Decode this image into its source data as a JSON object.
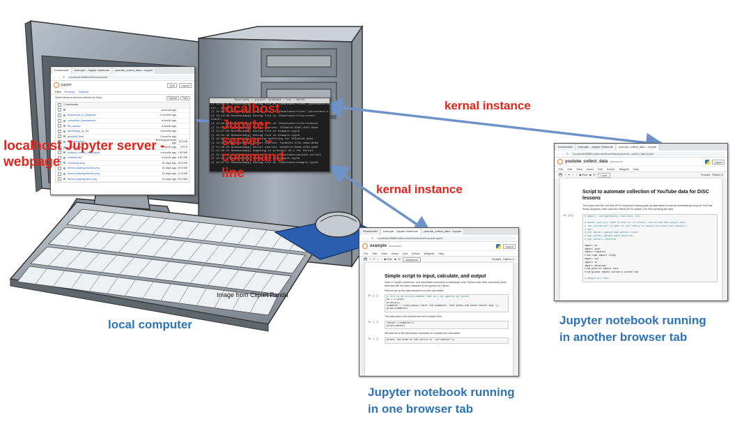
{
  "labels": {
    "kernal_top": "kernal instance",
    "kernal_mid": "kernal instance",
    "localhost_webpage": "localhost Jupyter server - webpage",
    "localhost_cmdline": "localhost Jupyter server – command line",
    "credit": "Image from Clipart Panda",
    "local_computer": "local computer",
    "nb_one_tab_line1": "Jupyter notebook running",
    "nb_one_tab_line2": "in one browser tab",
    "nb_another_tab_line1": "Jupyter notebook running",
    "nb_another_tab_line2": "in another browser tab"
  },
  "colors": {
    "label_red": "#e0251b",
    "label_blue": "#2e74b5",
    "arrow": "#6f93c9"
  },
  "tree_page": {
    "tab_labels": [
      "Downloads/",
      "example - Jupyter Notebook",
      "youtube_collect_data - Jupyter"
    ],
    "url": "localhost:8888/tree/Downloads",
    "logo_text": "jupyter",
    "quit_label": "Quit",
    "logout_label": "Logout",
    "tabs": [
      "Files",
      "Running",
      "Clusters"
    ],
    "select_hint": "Select items to perform actions on them.",
    "upload_label": "Upload",
    "new_label": "New",
    "breadcrumb": "/ Downloads",
    "files": [
      {
        "name": "..",
        "modified": "seconds ago",
        "size": ""
      },
      {
        "name": "bootcamps_in_progress",
        "modified": "2 months ago",
        "size": ""
      },
      {
        "name": "completed_transactions",
        "modified": "a month ago",
        "size": ""
      },
      {
        "name": "file_upload",
        "modified": "a month ago",
        "size": ""
      },
      {
        "name": "genealogy_ny_file",
        "modified": "4 months ago",
        "size": ""
      },
      {
        "name": "gradeoff_final",
        "modified": "2 months ago",
        "size": ""
      },
      {
        "name": "example.ipynb",
        "modified": "Running seconds ago",
        "size": "10.3 kB"
      },
      {
        "name": "rstudio.dmg",
        "modified": "a month ago",
        "size": "279 B"
      },
      {
        "name": "youtube_collect_data.ipynb",
        "modified": "4 months ago",
        "size": "1.69 MB"
      },
      {
        "name": "xnkiewx.dat",
        "modified": "a month ago",
        "size": "4.82 MB"
      },
      {
        "name": "christmas.dmg",
        "modified": "15 days ago",
        "size": "19.5 MB"
      },
      {
        "name": "demon-playing-kitchen.png",
        "modified": "15 days ago",
        "size": "20.8 MB"
      },
      {
        "name": "demon-playing-kitchen.png",
        "modified": "15 days ago",
        "size": "11.5 MB"
      },
      {
        "name": "demon-playing-fetch.png",
        "modified": "15 days ago",
        "size": "20.9 MB"
      }
    ]
  },
  "terminal": {
    "title": "Downloads — jupyter notebook — tty — 80×24",
    "lines": [
      "[I 11:04:21 NotebookApp] Saving file at /Downloads/files/.jjnotebook/conte",
      "nt/...ipynb",
      "[I 11:09:38 NotebookApp] Saving file at /Downloads/files/.iptcontent/n.ipy",
      "[I 11:14:39 NotebookApp] Saving file at /Downloads/files/conte",
      "ntent/...",
      "[I 11:19:38 NotebookApp] Saving file at /Downloads/files/content",
      "[I 11:24:45 NotebookApp] Kernel started: 3f82a1c0-d4e2-4b5f-9a1e",
      "[I 11:27:02 NotebookApp] Saving file at example.ipynb",
      "[I 11:31:44 NotebookApp] Saving file at example.ipynb",
      "[I 11:35:10 NotebookApp] Starting buffering for 3f82a1c0-d4e2",
      "[I 11:38:22 NotebookApp] Kernel started: 7ac9b2e1-5f3c-46bd-8e0a",
      "[I 11:38:50 NotebookApp] Kernel started: 91d4e7c2-0b8a-4f61-a3d5",
      "[I 11:40:15 NotebookApp] Adapting to protocol v5.1 for kernel",
      "[I 11:42:03 NotebookApp] Saving file at /Downloads/youtube_collect",
      "[I 11:44:27 NotebookApp] Saving file at example.ipynb",
      "[I 11:47:51 NotebookApp] Saving file at /Downloads/example.ipynb"
    ]
  },
  "nb_example": {
    "tab_labels": [
      "Downloads/",
      "example - Jupyter Notebook",
      "youtube_collect_data - Jupyter"
    ],
    "url": "localhost:8888/notebooks/Downloads/example.ipynb",
    "name": "example",
    "saved": "(autosaved)",
    "logout_label": "Logout",
    "menu": [
      "File",
      "Edit",
      "View",
      "Insert",
      "Cell",
      "Kernel",
      "Widgets",
      "Help"
    ],
    "trusted": "Trusted",
    "kernel_name": "Python 3",
    "cell_type": "Markdown",
    "toolbar_run": "Run",
    "title": "Simple script to input, calculate, and output",
    "intro": "Note: in Jupyter notebooks, non-executable comments in Markdown cells. Python code cells: comments (lines that start with the hash character #) are ignored by Python.",
    "setup": "First we set up the data needed to run the calculation",
    "cell1_prompt": "In [ ]:",
    "cell1_code": [
      "# This is an inline comment that will be ignored by Python",
      "pi = 3.14159",
      "print(pi)",
      "diameter = float(input('Enter the diameter, then press the Enter/return key:'))",
      "print(diameter)"
    ],
    "transform": "The data need to be transformed into a usable form",
    "cell2_prompt": "In [ ]:",
    "cell2_code": [
      "radius = diameter/2",
      "print(radius)"
    ],
    "info": "We have all of the information necessary to complete the calculation",
    "cell3_prompt": "In [ ]:",
    "cell3_code": [
      "print('The area of the circle is ',pi*radius**2)"
    ]
  },
  "nb_youtube": {
    "tab_labels": [
      "Downloads/",
      "example - Jupyter Notebook",
      "youtube_collect_data - Jupyter"
    ],
    "url": "localhost:8888/notebooks/Downloads/youtube_collect_data.ipynb",
    "name": "youtube_collect_data",
    "saved": "(autosaved)",
    "logout_label": "Logout",
    "menu": [
      "File",
      "Edit",
      "View",
      "Insert",
      "Cell",
      "Kernel",
      "Widgets",
      "Help"
    ],
    "trusted": "Trusted",
    "kernel_name": "Python 3",
    "cell_type": "Code",
    "toolbar_run": "Run",
    "title": "Script to automate collection of YouTube data for DiSC lessons",
    "intro": "This script uses the YouTube API to download viewing stats (as alternative to manual downloading using the YouTube Studio Analytics), then uses the GitHub API to update CSV files archiving the data.",
    "cell1_prompt": "In [1]:",
    "cell1_code": [
      "# import, configuration, functions, etc.",
      "",
      "# Notes: you will have to use PIP to install the GitHub and Google SDKs",
      "# The YouTube API is part of the family of Google APIs and uses Google's",
      "# SDK:",
      "# pip install google-api-python-client",
      "# pip install google-auth-oauthlib",
      "# pip install PyGithub",
      "",
      "import os",
      "import json",
      "import requests",
      "from time import sleep",
      "import csv",
      "import io",
      "import datetime",
      "from pathlib import Path",
      "from github import Github # GitHub SDK",
      "",
      "# Google API SDKs"
    ]
  }
}
